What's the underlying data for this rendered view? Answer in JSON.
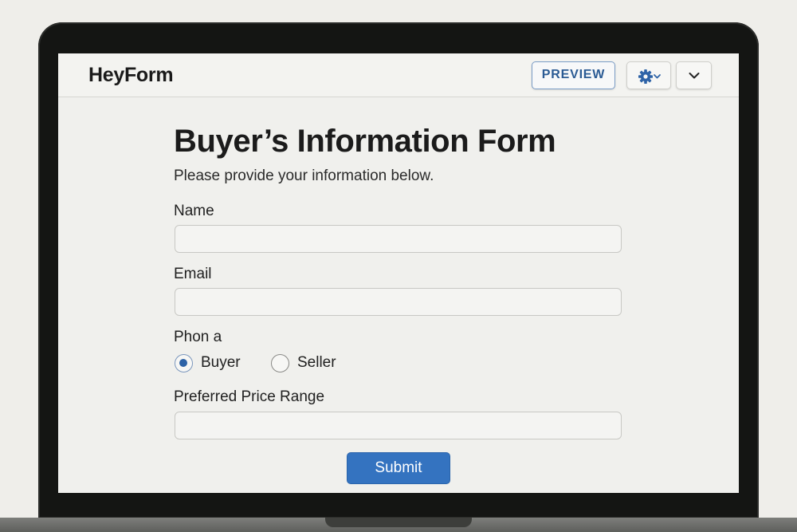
{
  "app": {
    "brand": "HeyForm"
  },
  "header": {
    "preview_label": "PREVIEW",
    "settings_icon": "gear-icon",
    "menu_icon": "chevron-down-icon"
  },
  "form": {
    "title": "Buyer’s Information Form",
    "subtitle": "Please provide your information below.",
    "fields": {
      "name": {
        "label": "Name",
        "value": ""
      },
      "email": {
        "label": "Email",
        "value": ""
      },
      "role": {
        "label": "Phon a",
        "options": [
          {
            "label": "Buyer",
            "selected": true
          },
          {
            "label": "Seller",
            "selected": false
          }
        ]
      },
      "price_range": {
        "label": "Preferred Price Range",
        "value": ""
      }
    },
    "submit_label": "Submit"
  },
  "colors": {
    "accent": "#3473c0",
    "preview_text": "#2b5b94",
    "radio_selected": "#2e63a7",
    "bezel": "#141513"
  }
}
